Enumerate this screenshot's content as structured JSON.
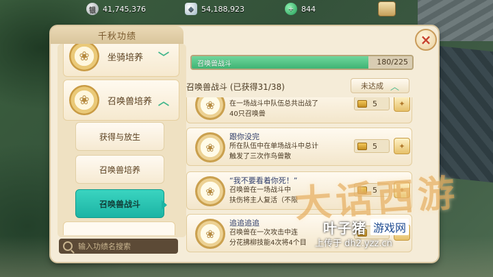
{
  "resources": [
    {
      "name": "silver",
      "value": "41,745,376",
      "icon": "silver-coin-icon"
    },
    {
      "name": "coins",
      "value": "54,188,923",
      "icon": "coin-stack-icon"
    },
    {
      "name": "jade",
      "value": "844",
      "icon": "jade-gem-icon"
    }
  ],
  "panel": {
    "title": "千秋功绩",
    "close_label": "×"
  },
  "left": {
    "categories": [
      {
        "label": "坐骑培养",
        "expanded": false
      },
      {
        "label": "召唤兽培养",
        "expanded": true
      }
    ],
    "subitems": [
      {
        "label": "获得与放生",
        "active": false
      },
      {
        "label": "召唤兽培养",
        "active": false
      },
      {
        "label": "召唤兽战斗",
        "active": true
      }
    ],
    "search_placeholder": "输入功绩名搜索"
  },
  "right": {
    "progress": {
      "label": "召唤兽战斗",
      "current": 180,
      "total": 225,
      "text": "180/225"
    },
    "section_title": "召唤兽战斗 (已获得31/38)",
    "status_label": "未达成",
    "items": [
      {
        "name": "",
        "desc1": "在一场战斗中队伍总共出战了",
        "desc2": "40只召唤兽",
        "reward": "5"
      },
      {
        "name": "跟你没完",
        "desc1": "所在队伍中在单场战斗中总计",
        "desc2": "触发了三次作鸟兽散",
        "reward": "5"
      },
      {
        "name": "“我不要看着你死！”",
        "desc1": "召唤兽在一场战斗中",
        "desc2": "扶伤将主人复活（不限",
        "reward": "5"
      },
      {
        "name": "追追追追",
        "desc1": "召唤兽在一次攻击中连",
        "desc2": "分花拂柳技能4次将4个目",
        "reward": "5"
      }
    ]
  },
  "watermark": {
    "logo": "大话西游",
    "site_cn": "叶子猪",
    "site_box": "游戏网",
    "upload": "上传于 dh2.yzz.cn"
  },
  "colors": {
    "accent": "#1cb4a4",
    "progress": "#3fb474",
    "close": "#c7412e"
  }
}
